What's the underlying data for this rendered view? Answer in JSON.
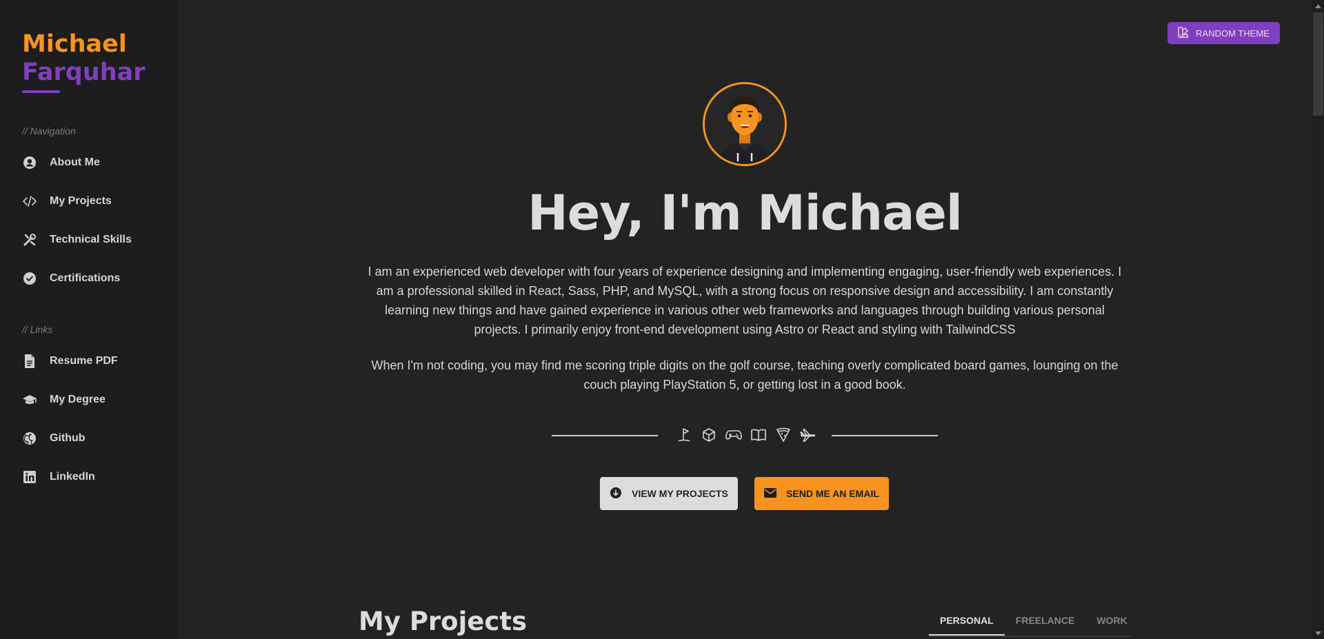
{
  "sidebar": {
    "first_name": "Michael",
    "last_name": "Farquhar",
    "navigation_label": "// Navigation",
    "navigation": [
      {
        "label": "About Me",
        "icon": "user-circle-icon"
      },
      {
        "label": "My Projects",
        "icon": "code-icon"
      },
      {
        "label": "Technical Skills",
        "icon": "tools-icon"
      },
      {
        "label": "Certifications",
        "icon": "check-badge-icon"
      }
    ],
    "links_label": "// Links",
    "links": [
      {
        "label": "Resume PDF",
        "icon": "document-icon"
      },
      {
        "label": "My Degree",
        "icon": "graduation-cap-icon"
      },
      {
        "label": "Github",
        "icon": "github-icon"
      },
      {
        "label": "LinkedIn",
        "icon": "linkedin-icon"
      }
    ]
  },
  "header": {
    "theme_button_label": "RANDOM THEME"
  },
  "hero": {
    "title": "Hey, I'm Michael",
    "paragraph1": "I am an experienced web developer with four years of experience designing and implementing engaging, user-friendly web experiences. I am a professional skilled in React, Sass, PHP, and MySQL, with a strong focus on responsive design and accessibility. I am constantly learning new things and have gained experience in various other web frameworks and languages through building various personal projects. I primarily enjoy front-end development using Astro or React and styling with TailwindCSS",
    "paragraph2": "When I'm not coding, you may find me scoring triple digits on the golf course, teaching overly complicated board games, lounging on the couch playing PlayStation 5, or getting lost in a good book.",
    "hobby_icons": [
      "golf-flag-icon",
      "box-icon",
      "gamepad-icon",
      "book-icon",
      "pizza-icon",
      "airplane-icon"
    ],
    "view_projects_label": "VIEW MY PROJECTS",
    "email_label": "SEND ME AN EMAIL"
  },
  "projects": {
    "title": "My Projects",
    "tabs": [
      {
        "label": "PERSONAL",
        "active": true
      },
      {
        "label": "FREELANCE",
        "active": false
      },
      {
        "label": "WORK",
        "active": false
      }
    ]
  },
  "colors": {
    "background": "#232323",
    "sidebar": "#1d1d1d",
    "accent_orange": "#f7931e",
    "accent_purple": "#7f3fbf"
  }
}
